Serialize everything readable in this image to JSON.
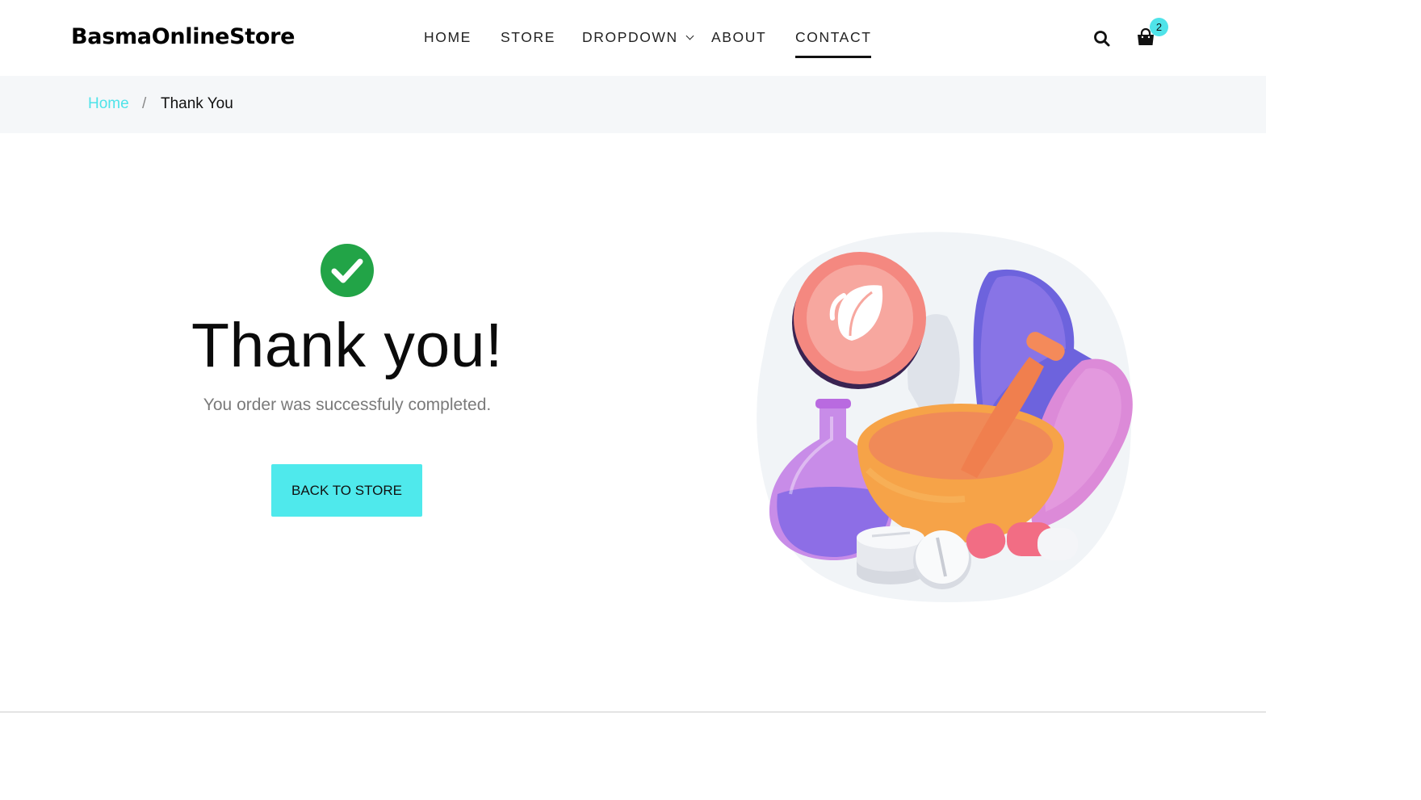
{
  "header": {
    "brand": "BasmaOnlineStore",
    "nav": [
      {
        "label": "HOME"
      },
      {
        "label": "STORE"
      },
      {
        "label": "DROPDOWN"
      },
      {
        "label": "ABOUT"
      },
      {
        "label": "CONTACT",
        "active": true
      }
    ],
    "icons": {
      "search": "search-icon",
      "cart": "shopping-bag-icon"
    },
    "cart_count": "2"
  },
  "breadcrumb": {
    "home": "Home",
    "separator": "/",
    "current": "Thank You"
  },
  "main": {
    "title": "Thank you!",
    "subtitle": "You order was successfuly completed.",
    "button_label": "BACK TO STORE",
    "status_icon": "check-circle-icon",
    "illustration": "pharmacy-mortar-and-pestle-illustration"
  },
  "colors": {
    "accent": "#4fe3e9",
    "success": "#22a447",
    "breadcrumb_bg": "#f5f7f9"
  }
}
